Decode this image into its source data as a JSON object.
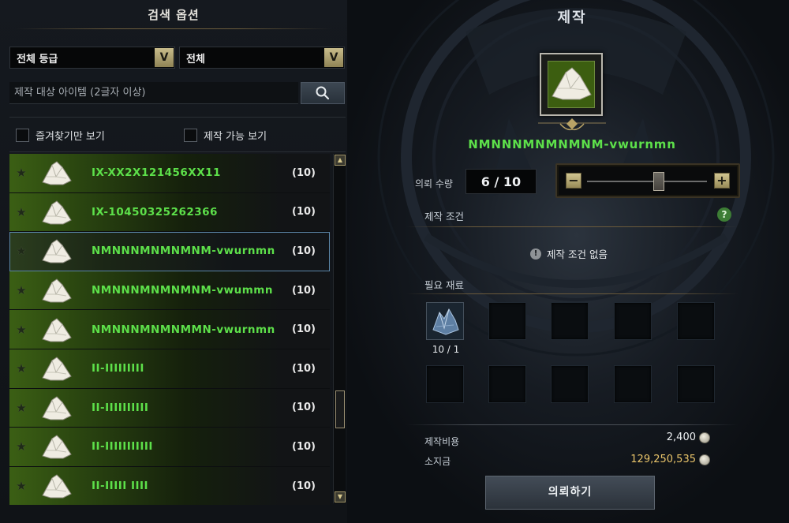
{
  "search_options": {
    "title": "검색 옵션",
    "grade_dropdown": "전체 등급",
    "category_dropdown": "전체",
    "search_placeholder": "제작 대상 아이템 (2글자 이상)",
    "favorites_only": "즐겨찾기만 보기",
    "craftable_only": "제작 가능 보기"
  },
  "item_list": [
    {
      "name": "IX-XX2X121456XX11",
      "count": "(10)"
    },
    {
      "name": "IX-10450325262366",
      "count": "(10)"
    },
    {
      "name": "NMNNNMNMNMNM-vwurnmn",
      "count": "(10)"
    },
    {
      "name": "NMNNNMNMNMNM-vwummn",
      "count": "(10)"
    },
    {
      "name": "NMNNNMNMNMMN-vwurnmn",
      "count": "(10)"
    },
    {
      "name": "II-IIIIIIIII",
      "count": "(10)"
    },
    {
      "name": "II-IIIIIIIIII",
      "count": "(10)"
    },
    {
      "name": "II-IIIIIIIIIII",
      "count": "(10)"
    },
    {
      "name": "II-IIIII IIII",
      "count": "(10)"
    }
  ],
  "selected_index": 2,
  "craft": {
    "title": "제작",
    "item_name": "NMNNNMNMNMNM-vwurnmn",
    "quantity_label": "의뢰 수량",
    "quantity": "6 / 10",
    "quantity_fraction": 0.6,
    "conditions_label": "제작 조건",
    "no_conditions": "제작 조건 없음",
    "materials_label": "필요 재료",
    "material_count": "10 / 1",
    "cost_label": "제작비용",
    "cost_value": "2,400",
    "balance_label": "소지금",
    "balance_value": "129,250,535",
    "button_label": "의뢰하기"
  },
  "colors": {
    "item_green": "#5de04a",
    "gold": "#e9c46a",
    "accent": "#b8ad7b"
  }
}
